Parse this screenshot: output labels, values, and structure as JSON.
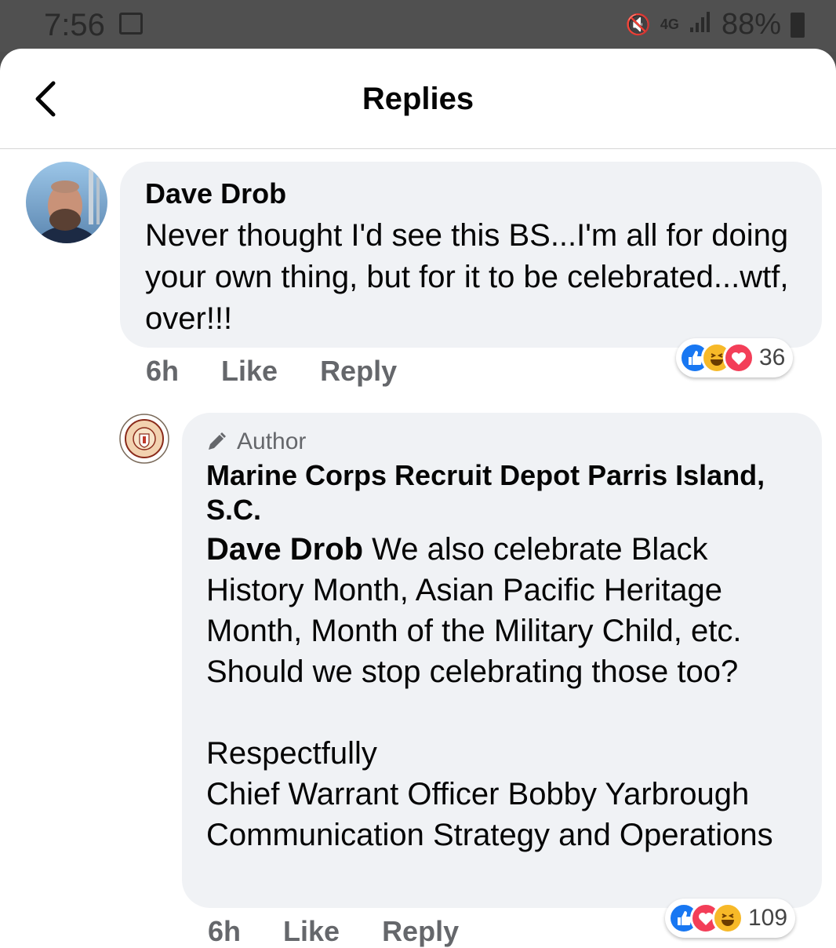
{
  "status_bar": {
    "time": "7:56",
    "network": "4G",
    "battery": "88%"
  },
  "header": {
    "title": "Replies"
  },
  "comment1": {
    "author": "Dave Drob",
    "text": "Never thought I'd see this BS...I'm all for doing your own thing, but for it to be celebrated...wtf, over!!!",
    "time": "6h",
    "like_label": "Like",
    "reply_label": "Reply",
    "reaction_count": "36",
    "reactions": [
      "like-icon",
      "haha-icon",
      "love-icon"
    ]
  },
  "comment2": {
    "badge": "Author",
    "author": "Marine Corps Recruit Depot Parris Island, S.C.",
    "mention": "Dave Drob",
    "text": " We also celebrate Black History Month, Asian Pacific Heritage Month, Month of the Military Child, etc. Should we stop celebrating those too?\n\nRespectfully\nChief Warrant Officer Bobby Yarbrough\nCommunication Strategy and Operations",
    "time": "6h",
    "like_label": "Like",
    "reply_label": "Reply",
    "reaction_count": "109",
    "reactions": [
      "like-icon",
      "love-icon",
      "haha-icon"
    ]
  },
  "colors": {
    "bubble": "#f0f2f5",
    "meta": "#65676b",
    "like": "#1877f2",
    "love": "#f33e58",
    "haha": "#f7b928"
  }
}
